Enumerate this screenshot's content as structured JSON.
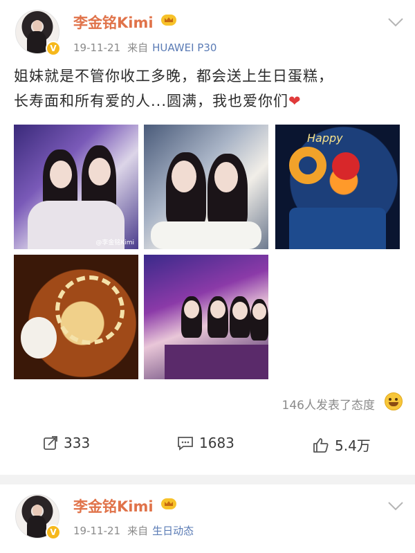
{
  "post1": {
    "author": "李金铭Kimi",
    "date": "19-11-21",
    "source_prefix": "来自",
    "source": "HUAWEI P30",
    "text_line1": "姐妹就是不管你收工多晚，都会送上生日蛋糕，",
    "text_line2": "长寿面和所有爱的人...圆满，我也爱你们",
    "reactions_text": "146人发表了态度",
    "reposts": "333",
    "comments": "1683",
    "likes": "5.4万",
    "photo_watermark": "@李金铭Kimi"
  },
  "post2": {
    "author": "李金铭Kimi",
    "date": "19-11-21",
    "source_prefix": "来自",
    "source": "生日动态"
  },
  "colors": {
    "username": "#e0734a",
    "verified_badge": "#f6b81c",
    "heart": "#e03a3a"
  },
  "icons": [
    "crown-icon",
    "verified-v-icon",
    "chevron-down-icon",
    "heart-emoji",
    "laugh-emoji",
    "repost-icon",
    "comment-icon",
    "like-icon"
  ]
}
